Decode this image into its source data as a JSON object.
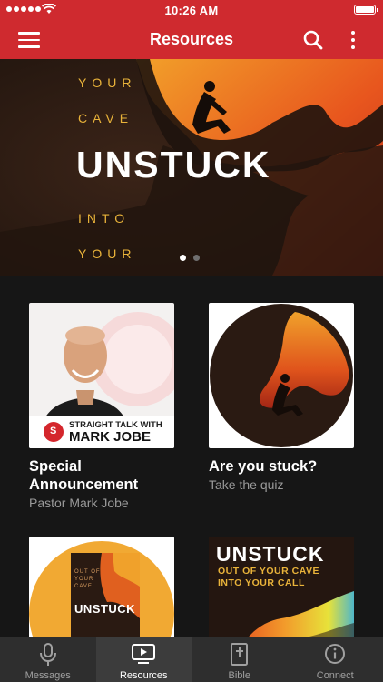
{
  "status": {
    "time": "10:26 AM"
  },
  "nav": {
    "title": "Resources"
  },
  "hero": {
    "lines": [
      "YOUR",
      "CAVE",
      "UNSTUCK",
      "INTO",
      "YOUR"
    ],
    "page_count": 2,
    "active_page": 1
  },
  "cards": [
    {
      "title": "Special Announcement",
      "subtitle": "Pastor Mark Jobe",
      "art_caption_top": "STRAIGHT TALK WITH",
      "art_caption_bottom": "MARK JOBE",
      "art_logo": "S"
    },
    {
      "title": "Are you stuck?",
      "subtitle": "Take the quiz"
    },
    {
      "art_title": "UNSTUCK",
      "art_small": [
        "OUT OF",
        "YOUR",
        "CAVE"
      ]
    },
    {
      "art_title": "UNSTUCK",
      "art_sub1": "OUT OF YOUR CAVE",
      "art_sub2": "INTO YOUR CALL"
    }
  ],
  "tabs": [
    {
      "label": "Messages",
      "icon": "microphone-icon",
      "active": false
    },
    {
      "label": "Resources",
      "icon": "tv-play-icon",
      "active": true
    },
    {
      "label": "Bible",
      "icon": "bible-icon",
      "active": false
    },
    {
      "label": "Connect",
      "icon": "info-icon",
      "active": false
    }
  ],
  "colors": {
    "brand_red": "#cf2a2f",
    "hero_gold": "#e9b33a",
    "background": "#161616"
  }
}
